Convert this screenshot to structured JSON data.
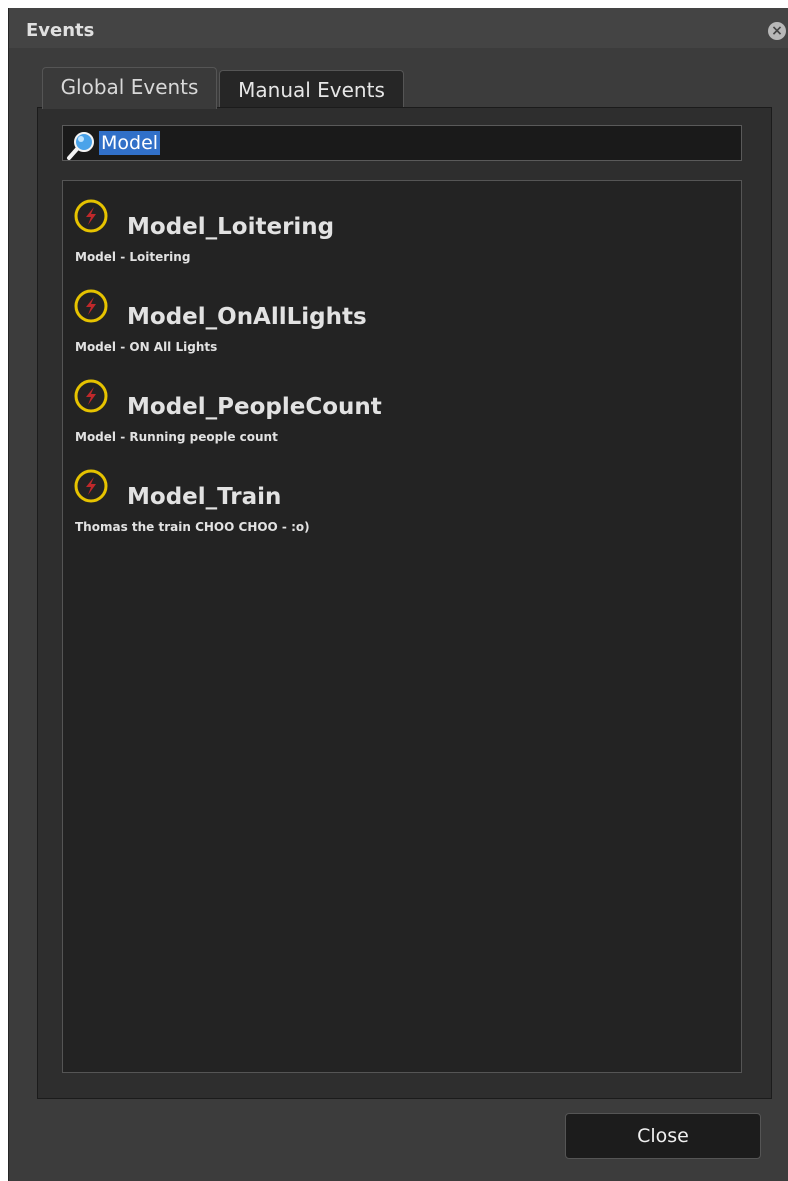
{
  "window": {
    "title": "Events",
    "close_icon": "×"
  },
  "tabs": [
    {
      "label": "Global Events",
      "selected": true
    },
    {
      "label": "Manual Events",
      "selected": false
    }
  ],
  "search": {
    "value": "Model",
    "icon": "search-icon"
  },
  "events": [
    {
      "name": "Model_Loitering",
      "description": "Model - Loitering",
      "icon": "lightning-bolt-icon"
    },
    {
      "name": "Model_OnAllLights",
      "description": "Model - ON All Lights",
      "icon": "lightning-bolt-icon"
    },
    {
      "name": "Model_PeopleCount",
      "description": "Model - Running people count",
      "icon": "lightning-bolt-icon"
    },
    {
      "name": "Model_Train",
      "description": "Thomas the train CHOO CHOO - :o)",
      "icon": "lightning-bolt-icon"
    }
  ],
  "buttons": {
    "close_label": "Close"
  },
  "colors": {
    "window_bg": "#3c3c3c",
    "list_bg": "#232323",
    "selection": "#3170c8",
    "event_ring": "#e6c300",
    "event_bolt": "#c0282a"
  }
}
